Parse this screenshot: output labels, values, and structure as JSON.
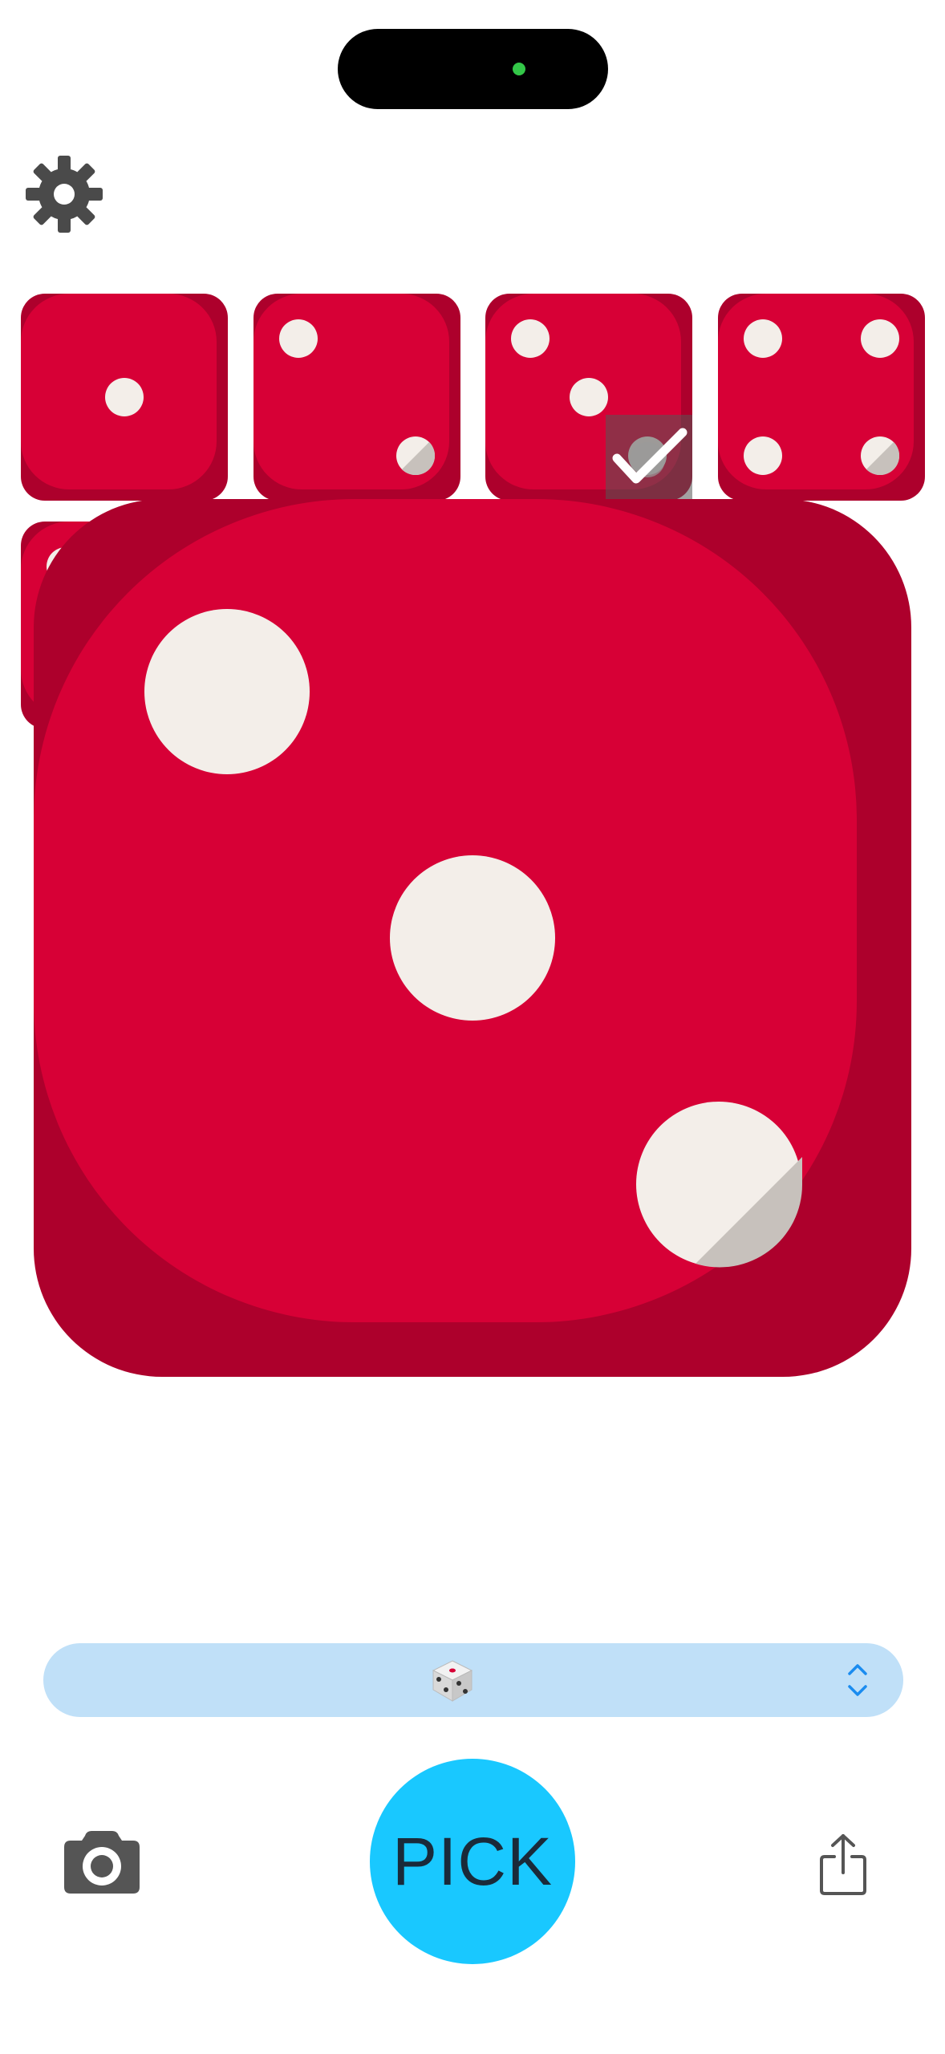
{
  "toolbar": {
    "settings_icon": "gear-icon"
  },
  "dice_strip": [
    {
      "value": 1,
      "selected": false
    },
    {
      "value": 2,
      "selected": false
    },
    {
      "value": 3,
      "selected": true
    },
    {
      "value": 4,
      "selected": false
    }
  ],
  "main_die": {
    "value": 3
  },
  "selector": {
    "die_icon": "die-icon",
    "chevron_icon": "chevron-up-down-icon"
  },
  "bottom_bar": {
    "camera_icon": "camera-icon",
    "pick_label": "PICK",
    "share_icon": "share-icon"
  },
  "colors": {
    "die_face": "#d70036",
    "die_shadow": "#ad002c",
    "pip": "#f3eee9",
    "pick_button": "#19c8ff",
    "selector_bg": "#c0e0f8"
  }
}
